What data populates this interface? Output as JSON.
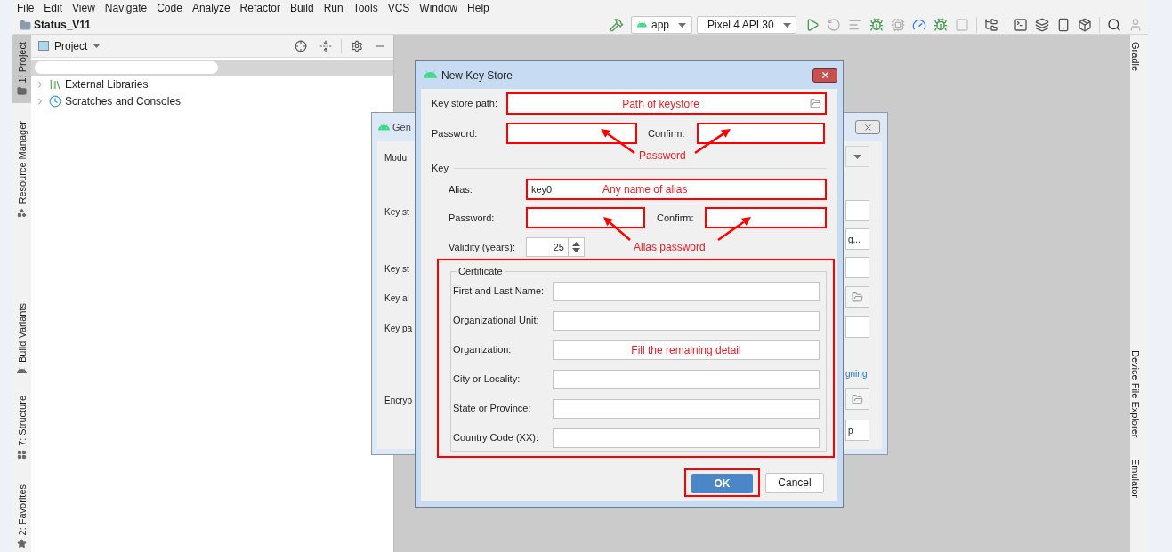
{
  "menu_bar": [
    "File",
    "Edit",
    "View",
    "Navigate",
    "Code",
    "Analyze",
    "Refactor",
    "Build",
    "Run",
    "Tools",
    "VCS",
    "Window",
    "Help"
  ],
  "project_name": "Status_V11",
  "toolbar": {
    "run_config": "app",
    "device": "Pixel 4 API 30"
  },
  "left_tool_tabs": [
    {
      "label": "1: Project",
      "selected": true
    },
    {
      "label": "Resource Manager",
      "selected": false
    },
    {
      "label": "Build Variants",
      "selected": false
    },
    {
      "label": "7: Structure",
      "selected": false
    },
    {
      "label": "2: Favorites",
      "selected": false
    }
  ],
  "right_tool_tabs": [
    {
      "label": "Gradle"
    },
    {
      "label": "Device File Explorer"
    },
    {
      "label": "Emulator"
    }
  ],
  "project_panel": {
    "title": "Project",
    "items": [
      {
        "label": "External Libraries",
        "expanded": false
      },
      {
        "label": "Scratches and Consoles",
        "expanded": false
      }
    ]
  },
  "background_dialog": {
    "title": "Gen",
    "rows": [
      {
        "label": "Modu",
        "kind": "dropdown"
      },
      {
        "label": "Key st",
        "kind": "field"
      },
      {
        "kind": "button",
        "text": "g..."
      },
      {
        "label": "Key st",
        "kind": "field"
      },
      {
        "label": "Key al",
        "kind": "folder_field"
      },
      {
        "label": "Key pa",
        "kind": "field"
      },
      {
        "kind": "link",
        "text": "gning"
      },
      {
        "label": "Encryp",
        "kind": "folder_field"
      },
      {
        "kind": "button",
        "text": "p"
      }
    ]
  },
  "dialog": {
    "title": "New Key Store",
    "key_store_path": {
      "label": "Key store path:",
      "annotation": "Path of keystore"
    },
    "password": {
      "label": "Password:"
    },
    "confirm": {
      "label": "Confirm:"
    },
    "password_annotation": "Password",
    "key_section": "Key",
    "alias": {
      "label": "Alias:",
      "value": "key0",
      "annotation": "Any name of alias"
    },
    "key_password": {
      "label": "Password:"
    },
    "key_confirm": {
      "label": "Confirm:"
    },
    "validity": {
      "label": "Validity (years):",
      "value": "25"
    },
    "alias_password_annotation": "Alias password",
    "certificate": {
      "title": "Certificate",
      "fields": [
        {
          "label": "First and Last Name:"
        },
        {
          "label": "Organizational Unit:"
        },
        {
          "label": "Organization:",
          "annotation": "Fill the remaining detail"
        },
        {
          "label": "City or Locality:"
        },
        {
          "label": "State or Province:"
        },
        {
          "label": "Country Code (XX):"
        }
      ]
    },
    "buttons": {
      "ok": "OK",
      "cancel": "Cancel"
    }
  }
}
